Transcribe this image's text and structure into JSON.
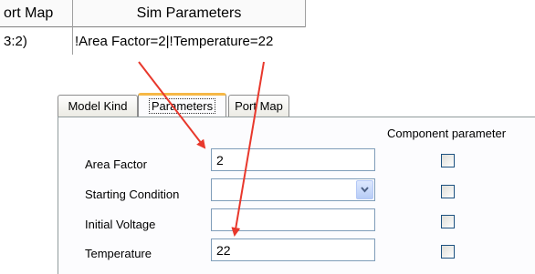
{
  "grid": {
    "headers": [
      "ort Map",
      "Sim Parameters"
    ],
    "row": [
      "3:2)",
      "!Area Factor=2|!Temperature=22"
    ]
  },
  "dialog": {
    "tabs": [
      {
        "label": "Model Kind",
        "active": false
      },
      {
        "label": "Parameters",
        "active": true
      },
      {
        "label": "Port Map",
        "active": false
      }
    ],
    "component_parameter_header": "Component parameter",
    "fields": [
      {
        "label": "Area Factor",
        "value": "2",
        "type": "text",
        "component_parameter": false
      },
      {
        "label": "Starting Condition",
        "value": "",
        "type": "select",
        "component_parameter": false
      },
      {
        "label": "Initial Voltage",
        "value": "",
        "type": "text",
        "component_parameter": false
      },
      {
        "label": "Temperature",
        "value": "22",
        "type": "text",
        "component_parameter": false
      }
    ]
  },
  "annotations": {
    "arrow_color": "#e8382c"
  },
  "icons": {
    "dropdown": "chevron-down-icon"
  }
}
